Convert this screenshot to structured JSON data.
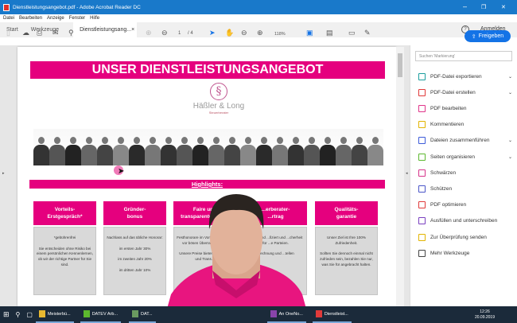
{
  "window": {
    "title": "Dienstleistungsangebot.pdf - Adobe Acrobat Reader DC",
    "controls": [
      "–",
      "❐",
      "✕"
    ]
  },
  "menu": [
    "Datei",
    "Bearbeiten",
    "Anzeige",
    "Fenster",
    "Hilfe"
  ],
  "tabs": {
    "start": "Start",
    "tools": "Werkzeuge",
    "doc": "Dienstleistungsang...",
    "close": "×",
    "help": "?",
    "signin": "Anmelden"
  },
  "toolbar": {
    "page_current": "1",
    "page_total": "/ 4",
    "zoom": "118%",
    "share": "Freigeben"
  },
  "document": {
    "title": "UNSER DIENSTLEISTUNGSANGEBOT",
    "logo": {
      "name": "Häßler & Long",
      "sub": "Steuerberater",
      "symbol": "§"
    },
    "highlights": "Highlights:",
    "cards": [
      {
        "header": "Vorteils-\nErstgespräch*",
        "body": "*gebührenfrei\n\nSie entscheiden ohne Risiko bei einem persönlichen Kennenlernen,\nob wir der richtige Partner für Sie sind."
      },
      {
        "header": "Gründer-\nbonus",
        "body": "Nachlass auf das übliche Honorar:\n\nim ersten Jahr 30%\n\nim zweiten Jahr 20%\n\nim dritten Jahr 10%"
      },
      {
        "header": "Faire und\ntransparente Preise",
        "body": "Festhonorare im Vorfeld bewahren vor bösen Überraschungen.\n\nUnsere Preise bieten Sicherheit und Trans..."
      },
      {
        "header": "...erberater-\n...rtrag",
        "body": "...ein\" sind ...fiziert und ...cherheit für ...e Parteien.\n\n...echnung und ...tellen"
      },
      {
        "header": "Qualitäts-\ngarantie",
        "body": "Unser Ziel ist Ihre 100% Zufriedenheit.\n\nSollten Sie dennoch einmal nicht zufrieden sein, bezahlen Sie nur, was Sie für angebracht halten."
      }
    ]
  },
  "right_panel": {
    "search_placeholder": "Suchen 'Markierung'",
    "tools": [
      {
        "label": "PDF-Datei exportieren",
        "color": "#1b9e9e",
        "expand": true
      },
      {
        "label": "PDF-Datei erstellen",
        "color": "#e03a3a",
        "expand": true
      },
      {
        "label": "PDF bearbeiten",
        "color": "#e0358a",
        "expand": false
      },
      {
        "label": "Kommentieren",
        "color": "#e2b400",
        "expand": false
      },
      {
        "label": "Dateien zusammenführen",
        "color": "#3d5bd9",
        "expand": true
      },
      {
        "label": "Seiten organisieren",
        "color": "#5cb82e",
        "expand": true
      },
      {
        "label": "Schwärzen",
        "color": "#d6338a",
        "expand": false
      },
      {
        "label": "Schützen",
        "color": "#4a55c8",
        "expand": false
      },
      {
        "label": "PDF optimieren",
        "color": "#e03a3a",
        "expand": false
      },
      {
        "label": "Ausfüllen und unterschreiben",
        "color": "#7a3fc0",
        "expand": false
      },
      {
        "label": "Zur Überprüfung senden",
        "color": "#e2b400",
        "expand": false
      },
      {
        "label": "Mehr Werkzeuge",
        "color": "#444444",
        "expand": false
      }
    ]
  },
  "taskbar": {
    "items": [
      {
        "label": "Meisterbü...",
        "color": "#e8b830"
      },
      {
        "label": "DATEV Arb...",
        "color": "#5cb82e"
      },
      {
        "label": "DAT...",
        "color": "#6a9a60"
      },
      {
        "label": "An OneNo...",
        "color": "#8844aa"
      },
      {
        "label": "Dienstleist...",
        "color": "#e03a3a"
      }
    ],
    "time": "12:26",
    "date": "20.09.2019"
  },
  "colors": {
    "brand": "#e5007e",
    "accent": "#1473e6"
  }
}
